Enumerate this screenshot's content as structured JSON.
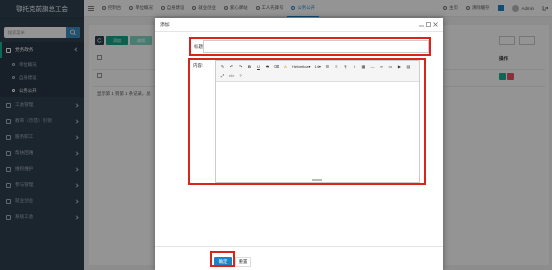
{
  "app": {
    "brand": "鄂托克前旗总工会"
  },
  "sidebar": {
    "search_placeholder": "搜索菜单",
    "items": [
      {
        "label": "党务政务"
      },
      {
        "label": "单位概况"
      },
      {
        "label": "自身建设"
      },
      {
        "label": "公务公开"
      },
      {
        "label": "工会管理"
      },
      {
        "label": "教育（示范）引领"
      },
      {
        "label": "服务职工"
      },
      {
        "label": "帮扶困难"
      },
      {
        "label": "维权维护"
      },
      {
        "label": "参与管理"
      },
      {
        "label": "就业创业"
      },
      {
        "label": "系统工会"
      }
    ]
  },
  "topbar": {
    "tabs": [
      {
        "label": "控制台"
      },
      {
        "label": "单位概况"
      },
      {
        "label": "自身建设"
      },
      {
        "label": "就业创业"
      },
      {
        "label": "爱心驿站"
      },
      {
        "label": "工人先锋号"
      },
      {
        "label": "公务公开"
      }
    ],
    "home": "主页",
    "clear_cache": "清除缓存",
    "user": "Admin"
  },
  "list": {
    "add": "添加",
    "edit": "编辑",
    "ops_header": "操作",
    "pager": "显示第 1 到第 1 条记录，总"
  },
  "modal": {
    "title": "添加",
    "title_label": "标题:",
    "content_label": "内容:",
    "font_select": "Helvetica",
    "size_select": "14",
    "confirm": "确定",
    "reset": "重置"
  },
  "colors": {
    "accent": "#1c84c6",
    "sidebar_bg": "#2f4050",
    "success": "#1ab394",
    "danger": "#ed5565",
    "highlight": "#d9241d"
  }
}
